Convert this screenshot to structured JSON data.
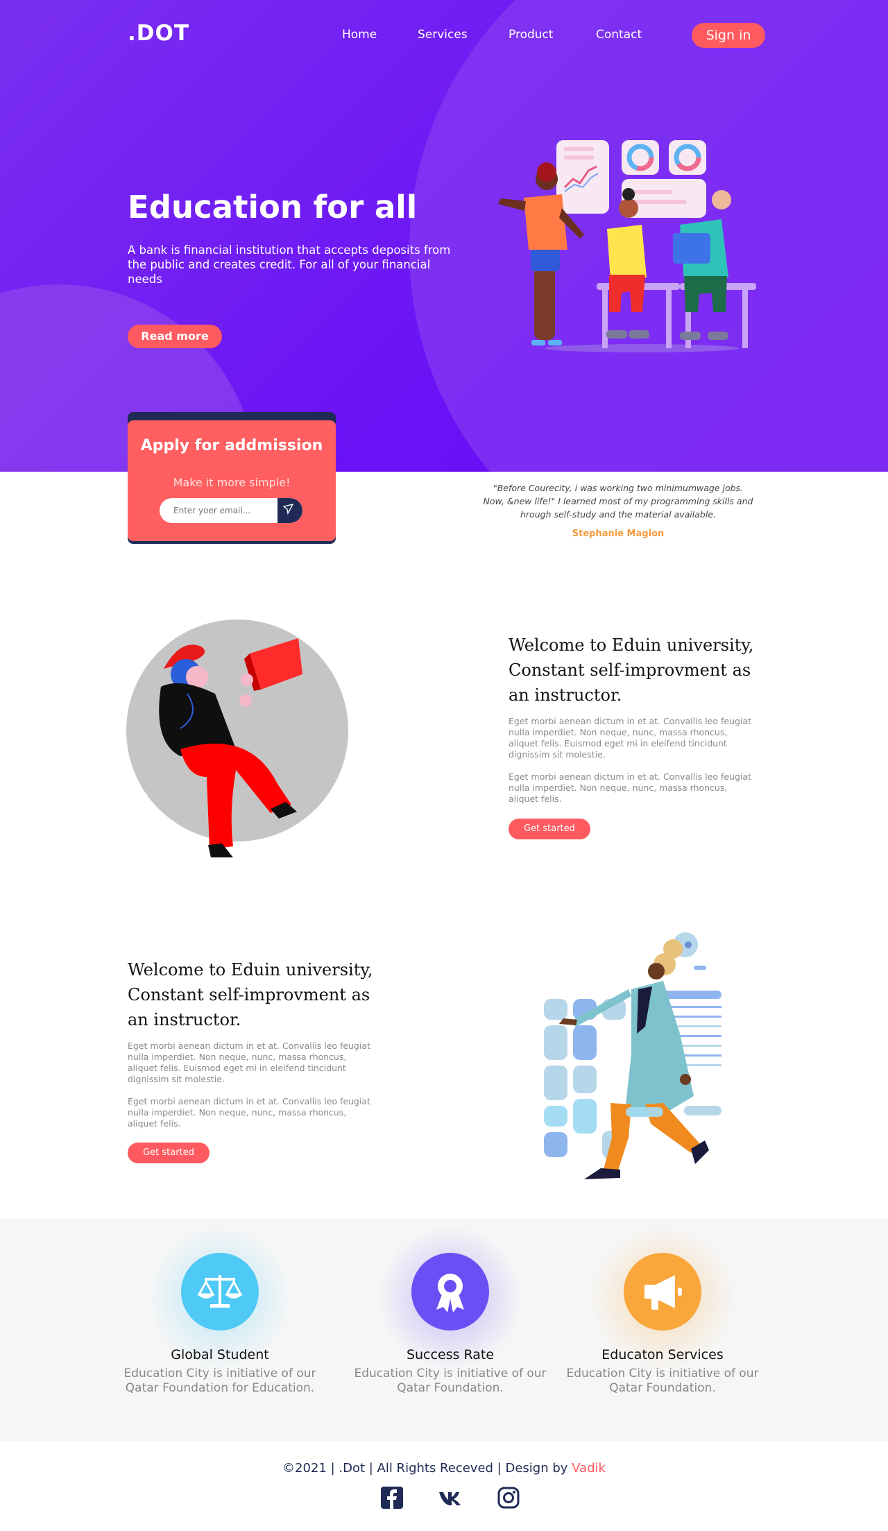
{
  "brand": ".DOT",
  "nav": [
    "Home",
    "Services",
    "Product",
    "Contact"
  ],
  "signin_label": "Sign in",
  "hero": {
    "title": "Education for all",
    "description": "A bank is financial institution that accepts deposits from the public and creates credit. For all of your financial needs",
    "cta": "Read more"
  },
  "apply": {
    "title": "Apply for addmission",
    "subtitle": "Make it more simple!",
    "email_placeholder": "Enter yoer email..."
  },
  "testimonial": {
    "quote": "\"Before Courecity, i was working two minimumwage jobs. Now, &new life!\" I learned most of my programming skills and hrough self-study and the material available.",
    "author": "Stephanie Magion"
  },
  "features": [
    {
      "title": "Welcome to Eduin university, Constant self-improvment as an instructor.",
      "p1": "Eget morbi aenean dictum in et at. Convallis leo feugiat nulla imperdiet. Non neque, nunc, massa rhoncus, aliquet felis. Euismod eget mi in eleifend tincidunt dignissim sit molestie.",
      "p2": "Eget morbi aenean dictum in et at. Convallis leo feugiat nulla imperdiet. Non neque, nunc, massa rhoncus, aliquet felis.",
      "cta": "Get started"
    },
    {
      "title": "Welcome to Eduin university, Constant self-improvment as an instructor.",
      "p1": "Eget morbi aenean dictum in et at. Convallis leo feugiat nulla imperdiet. Non neque, nunc, massa rhoncus, aliquet felis. Euismod eget mi in eleifend tincidunt dignissim sit molestie.",
      "p2": "Eget morbi aenean dictum in et at. Convallis leo feugiat nulla imperdiet. Non neque, nunc, massa rhoncus, aliquet felis.",
      "cta": "Get started"
    }
  ],
  "stats": [
    {
      "title": "Global Student",
      "desc": "Education City is initiative of our Qatar Foundation for Education.",
      "icon": "scales-icon",
      "color": "#4fc9f5"
    },
    {
      "title": "Success Rate",
      "desc": "Education City is initiative of our Qatar Foundation.",
      "icon": "award-icon",
      "color": "#6a4ff5"
    },
    {
      "title": "Educaton Services",
      "desc": "Education City is initiative of our Qatar Foundation.",
      "icon": "megaphone-icon",
      "color": "#f9a63a"
    }
  ],
  "footer": {
    "prefix": "©2021 | .Dot | All Rights Receved | Design by ",
    "author": "Vadik"
  },
  "social": [
    "facebook-icon",
    "vk-icon",
    "instagram-icon"
  ],
  "colors": {
    "primary": "#6b0af7",
    "accent": "#ff5a5f",
    "navy": "#1f2a55"
  }
}
